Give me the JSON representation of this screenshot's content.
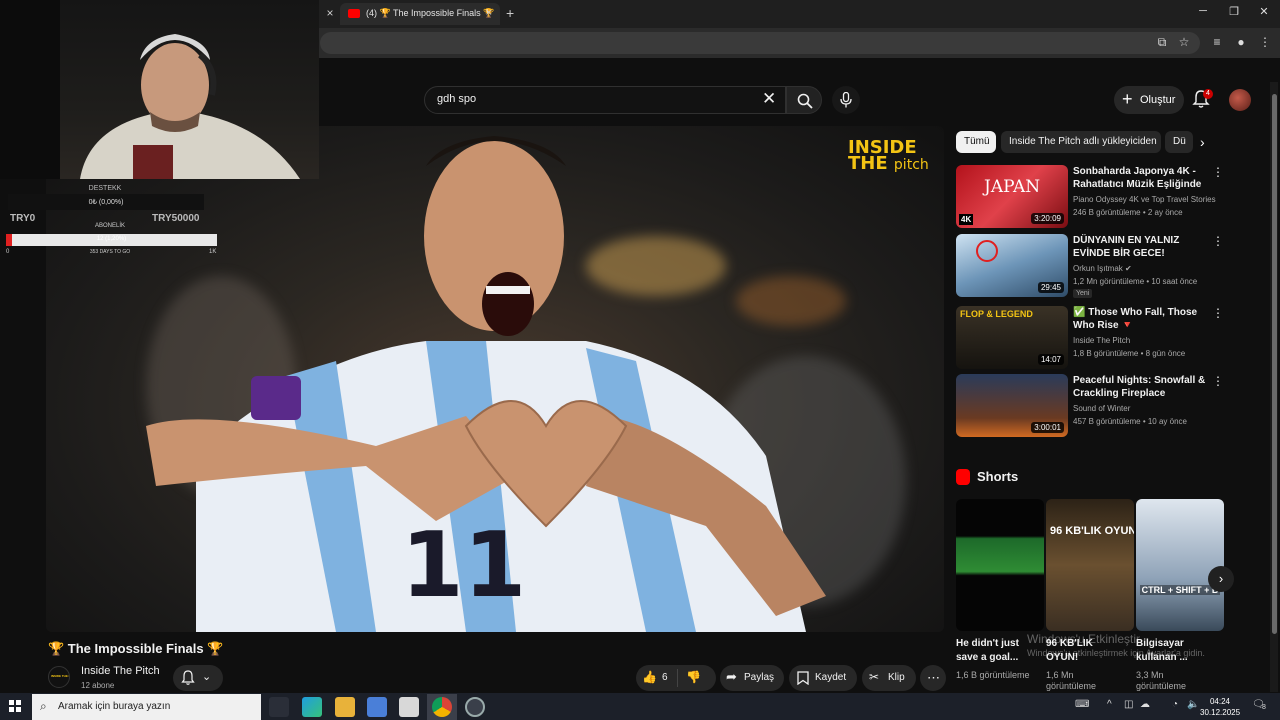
{
  "browser": {
    "tab_title": "(4) 🏆 The Impossible Finals 🏆",
    "tab_close": "×",
    "new_tab": "+",
    "window_controls": [
      "─",
      "❐",
      "✕"
    ]
  },
  "header": {
    "search_value": "gdh spo",
    "create_label": "Oluştur",
    "notification_count": "4"
  },
  "overlay": {
    "donation_title": "DESTEKK",
    "donation_value": "0₺ (0,00%)",
    "donation_min": "TRY0",
    "donation_max": "TRY50000",
    "sub_title": "ABONELİK",
    "sub_bar_text": "12 (1,20%)",
    "sub_progress": 0.012,
    "sub_min": "0",
    "sub_mid": "353 DAYS TO GO",
    "sub_max": "1K"
  },
  "player": {
    "logo_line1": "INSIDE",
    "logo_line2": "THE",
    "logo_suffix": "pitch"
  },
  "video": {
    "title": "🏆 The Impossible Finals 🏆",
    "channel": "Inside The Pitch",
    "channel_avatar_text": "INSIDE THE PITCH",
    "subscribers": "12 abone",
    "likes": "6",
    "share_label": "Paylaş",
    "save_label": "Kaydet",
    "clip_label": "Klip",
    "more": "⋯"
  },
  "chips": [
    "Tümü",
    "Inside The Pitch adlı yükleyiciden",
    "Dü"
  ],
  "recommendations": [
    {
      "title": "Sonbaharda Japonya 4K - Rahatlatıcı Müzik Eşliğinde ...",
      "channel": "Piano Odyssey 4K ve Top Travel Stories",
      "meta": "246 B görüntüleme • 2 ay önce",
      "duration": "3:20:09",
      "badge": "",
      "thumb_label": "JAPAN",
      "thumb_corner": "4K"
    },
    {
      "title": "DÜNYANIN EN YALNIZ EVİNDE BİR GECE!",
      "channel": "Orkun Işıtmak",
      "meta": "1,2 Mn görüntüleme • 10 saat önce",
      "duration": "29:45",
      "badge": "Yeni",
      "thumb_label": "",
      "thumb_corner": ""
    },
    {
      "title": "✅ Those Who Fall, Those Who Rise 🔻",
      "channel": "Inside The Pitch",
      "meta": "1,8 B görüntüleme • 8 gün önce",
      "duration": "14:07",
      "badge": "",
      "thumb_label": "FLOP & LEGEND",
      "thumb_corner": ""
    },
    {
      "title": "Peaceful Nights: Snowfall & Crackling Fireplace Ambiance...",
      "channel": "Sound of Winter",
      "meta": "457 B görüntüleme • 10 ay önce",
      "duration": "3:00:01",
      "badge": "",
      "thumb_label": "",
      "thumb_corner": ""
    }
  ],
  "shorts": {
    "section_title": "Shorts",
    "items": [
      {
        "title": "He didn't just save a goal...",
        "views": "1,6 B görüntüleme",
        "thumb_label": ""
      },
      {
        "title": "96 KB'LIK OYUN!",
        "views": "1,6 Mn görüntüleme",
        "thumb_label": "96 KB'LIK OYUN"
      },
      {
        "title": "Bilgisayar kullanan ...",
        "views": "3,3 Mn görüntüleme",
        "thumb_label": "CTRL + SHIFT + B"
      }
    ]
  },
  "watermark": {
    "line1": "Windows'u Etkinleştir",
    "line2": "Windows'u etkinleştirmek için Ayarlar'a gidin."
  },
  "taskbar": {
    "search_placeholder": "Aramak için buraya yazın",
    "time": "04:24",
    "date": "30.12.2025",
    "notification_count": "8"
  }
}
